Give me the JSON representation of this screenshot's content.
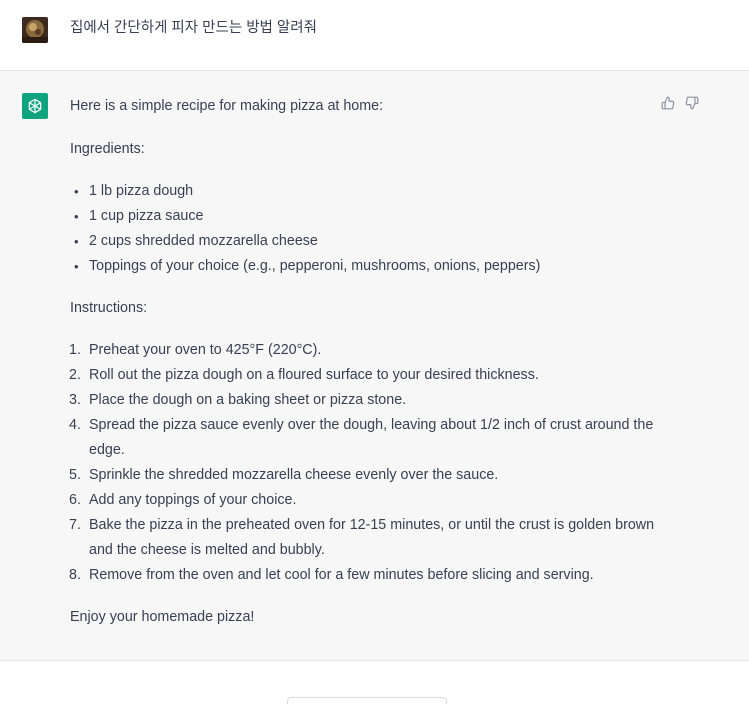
{
  "user_message": {
    "text": "집에서 간단하게 피자 만드는 방법 알려줘"
  },
  "assistant_message": {
    "intro": "Here is a simple recipe for making pizza at home:",
    "ingredients_heading": "Ingredients:",
    "ingredients": [
      "1 lb pizza dough",
      "1 cup pizza sauce",
      "2 cups shredded mozzarella cheese",
      "Toppings of your choice (e.g., pepperoni, mushrooms, onions, peppers)"
    ],
    "instructions_heading": "Instructions:",
    "steps": [
      {
        "num": "1.",
        "text": "Preheat your oven to 425°F (220°C)."
      },
      {
        "num": "2.",
        "text": "Roll out the pizza dough on a floured surface to your desired thickness."
      },
      {
        "num": "3.",
        "text": "Place the dough on a baking sheet or pizza stone."
      },
      {
        "num": "4.",
        "text": "Spread the pizza sauce evenly over the dough, leaving about 1/2 inch of crust around the edge."
      },
      {
        "num": "5.",
        "text": "Sprinkle the shredded mozzarella cheese evenly over the sauce."
      },
      {
        "num": "6.",
        "text": "Add any toppings of your choice."
      },
      {
        "num": "7.",
        "text": "Bake the pizza in the preheated oven for 12-15 minutes, or until the crust is golden brown and the cheese is melted and bubbly."
      },
      {
        "num": "8.",
        "text": "Remove from the oven and let cool for a few minutes before slicing and serving."
      }
    ],
    "closing": "Enjoy your homemade pizza!"
  },
  "icons": {
    "user_avatar": "user-avatar-image",
    "assistant_avatar": "openai-logo-icon",
    "thumbs_up": "thumbs-up-icon",
    "thumbs_down": "thumbs-down-icon"
  },
  "colors": {
    "assistant_bg": "#f7f7f8",
    "assistant_avatar_bg": "#10a37f",
    "text": "#374151"
  }
}
